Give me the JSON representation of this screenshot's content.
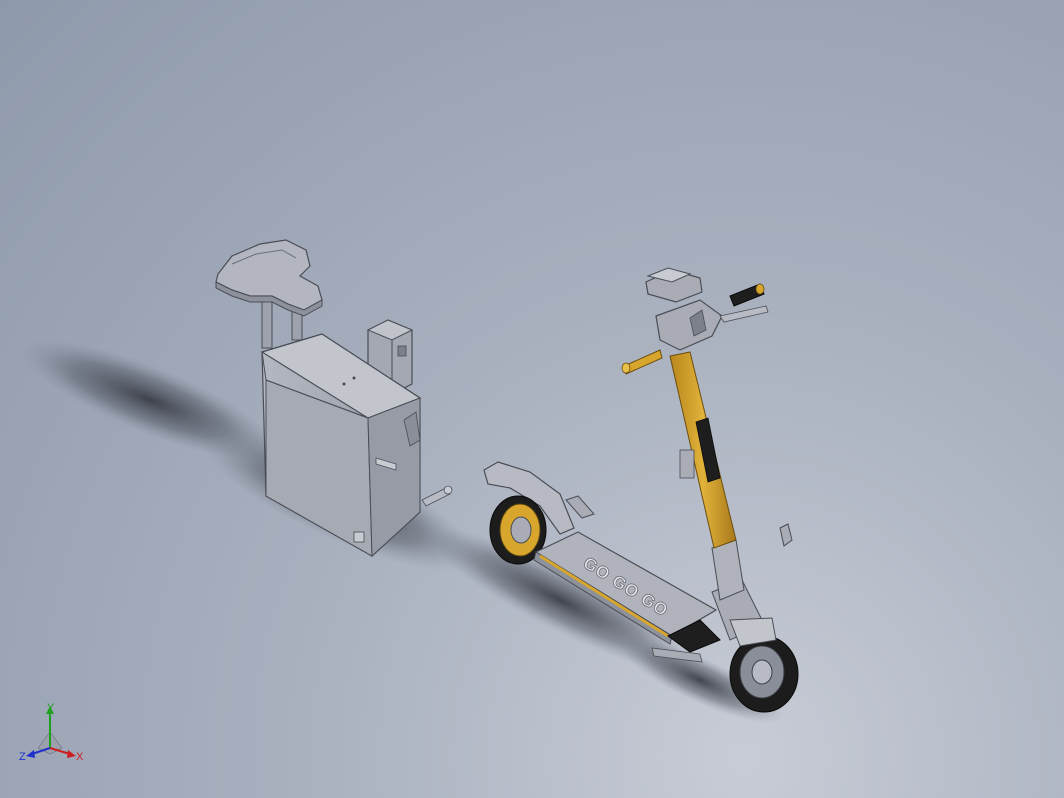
{
  "viewport": {
    "background_colors": [
      "#8e99ab",
      "#aab2c0",
      "#c8ccd6"
    ]
  },
  "model": {
    "parts": [
      "seat",
      "battery-box",
      "controller-box",
      "scooter"
    ],
    "deck_lettering": [
      "GO",
      "GO",
      "GO"
    ],
    "colors": {
      "body_gray": "#a9acb4",
      "accent_yellow": "#d8a62c",
      "tire_black": "#1c1c1c",
      "shadow": "#3a3e48"
    }
  },
  "triad": {
    "x_label": "X",
    "y_label": "Y",
    "z_label": "Z",
    "x_color": "#cc2020",
    "y_color": "#20a020",
    "z_color": "#2030cc"
  }
}
